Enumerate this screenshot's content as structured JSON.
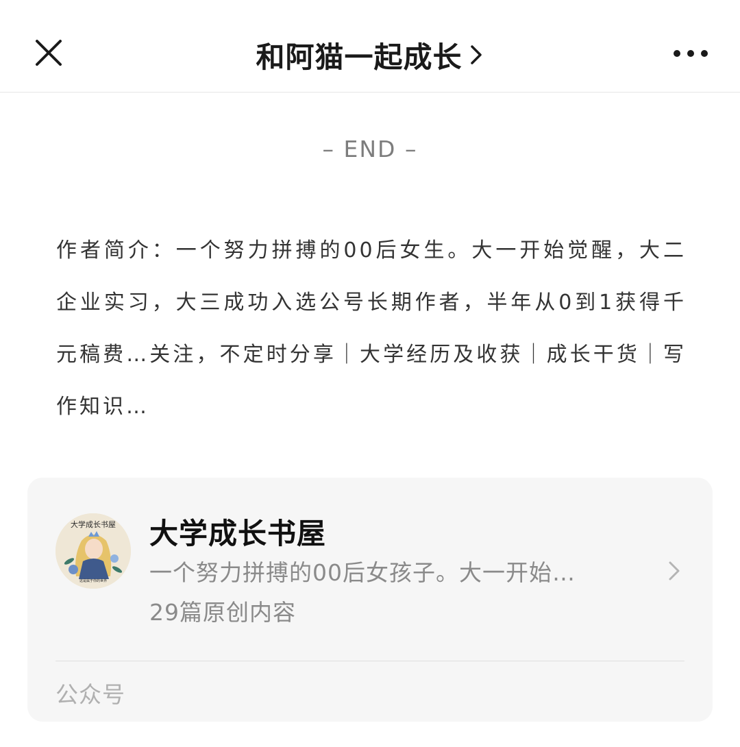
{
  "navbar": {
    "title": "和阿猫一起成长",
    "close_icon": "close-icon",
    "more_icon": "more-dots-icon",
    "title_chevron_icon": "chevron-right-icon"
  },
  "article": {
    "end_label": "– END –",
    "author_intro": "作者简介：一个努力拼搏的00后女生。大一开始觉醒，大二企业实习，大三成功入选公号长期作者，半年从0到1获得千元稿费…关注，不定时分享｜大学经历及收获｜成长干货｜写作知识…"
  },
  "profile_card": {
    "avatar_text_top": "大学成长书屋",
    "avatar_text_bottom": "这是属于你的世界",
    "name": "大学成长书屋",
    "description": "一个努力拼搏的00后女孩子。大一开始…",
    "original_count": "29篇原创内容",
    "footer_label": "公众号",
    "chevron_icon": "chevron-right-icon"
  },
  "colors": {
    "title_text": "#1a1a1a",
    "secondary_text": "#8a8a8a",
    "card_bg": "#f6f6f6",
    "end_text": "#7d7d7d"
  }
}
